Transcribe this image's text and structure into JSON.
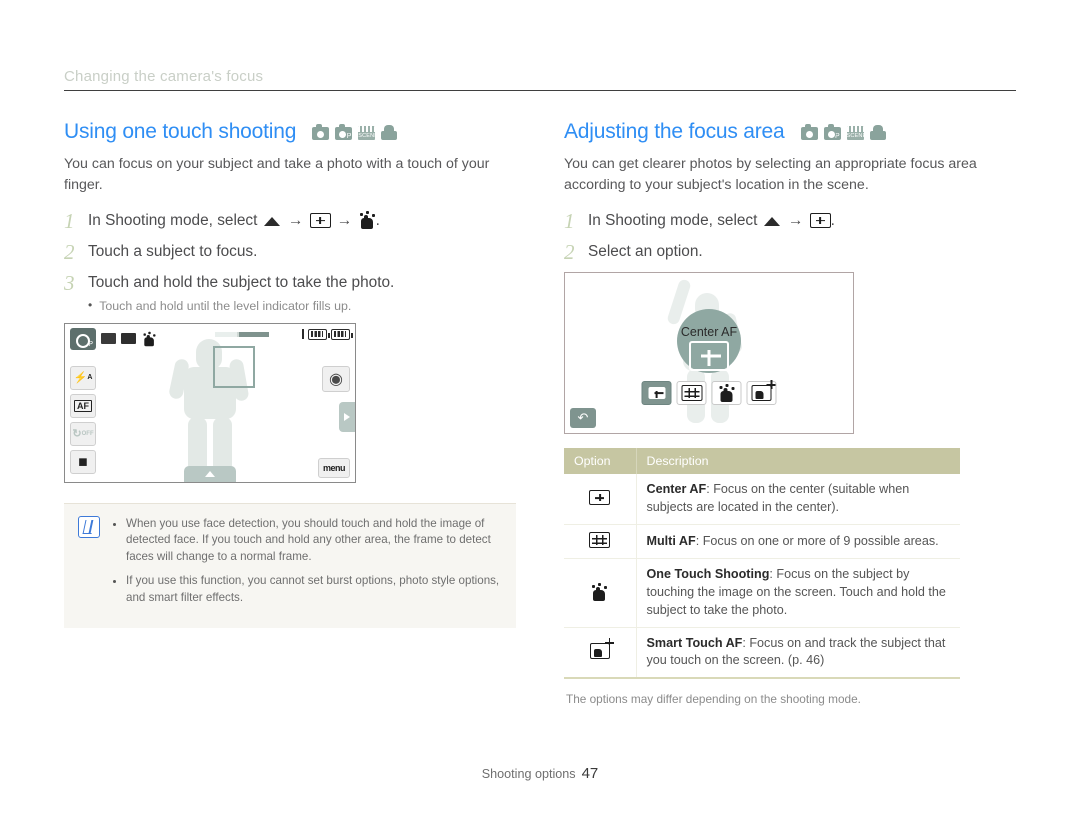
{
  "running_head": "Changing the camera's focus",
  "left_column": {
    "heading": "Using one touch shooting",
    "mode_icons": [
      "camera-icon",
      "camera-program-icon",
      "scene-icon",
      "movie-icon"
    ],
    "intro": "You can focus on your subject and take a photo with a touch of your finger.",
    "steps": [
      {
        "num": "1",
        "text_before": "In Shooting mode, select",
        "icons": [
          "triangle-up-icon",
          "boxed-plus-icon",
          "one-touch-hand-icon"
        ],
        "text_after": "."
      },
      {
        "num": "2",
        "text_before": "Touch a subject to focus.",
        "icons": [],
        "text_after": ""
      },
      {
        "num": "3",
        "text_before": "Touch and hold the subject to take the photo.",
        "icons": [],
        "text_after": "",
        "sub": "Touch and hold until the level indicator fills up."
      }
    ],
    "lcd": {
      "mode_badge": "P",
      "flash_label": "A",
      "af_label": "AF",
      "timer_label": "OFF",
      "menu_label": "menu"
    },
    "note": {
      "icon": "note-pen-icon",
      "items": [
        "When you use face detection, you should touch and hold the image of detected face. If you touch and hold any other area, the frame to detect faces will change to a normal frame.",
        "If you use this function, you cannot set burst options, photo style options, and smart filter effects."
      ]
    }
  },
  "right_column": {
    "heading": "Adjusting the focus area",
    "mode_icons": [
      "camera-icon",
      "camera-program-icon",
      "scene-icon",
      "movie-icon"
    ],
    "intro": "You can get clearer photos by selecting an appropriate focus area according to your subject's location in the scene.",
    "steps": [
      {
        "num": "1",
        "text_before": "In Shooting mode, select",
        "icons": [
          "triangle-up-icon",
          "boxed-plus-icon"
        ],
        "text_after": "."
      },
      {
        "num": "2",
        "text_before": "Select an option.",
        "icons": [],
        "text_after": ""
      }
    ],
    "lcd": {
      "center_label": "Center AF",
      "options": [
        "boxed-plus-icon",
        "multi-af-grid-icon",
        "one-touch-hand-icon",
        "smart-touch-af-icon"
      ],
      "back_label": "↶"
    },
    "table": {
      "headers": [
        "Option",
        "Description"
      ],
      "rows": [
        {
          "icon": "boxed-plus-icon",
          "term": "Center AF",
          "desc": ": Focus on the center (suitable when subjects are located in the center)."
        },
        {
          "icon": "multi-af-grid-icon",
          "term": "Multi AF",
          "desc": ": Focus on one or more of 9 possible areas."
        },
        {
          "icon": "one-touch-hand-icon",
          "term": "One Touch Shooting",
          "desc": ": Focus on the subject by touching the image on the screen. Touch and hold the subject to take the photo."
        },
        {
          "icon": "smart-touch-af-icon",
          "term": "Smart Touch AF",
          "desc": ": Focus on and track the subject that you touch on the screen. (p. 46)"
        }
      ]
    },
    "table_note": "The options may differ depending on the shooting mode."
  },
  "footer": {
    "section": "Shooting options",
    "page": "47"
  },
  "colors": {
    "heading_blue": "#2f8ef4",
    "step_number_green": "#c6d3b4",
    "table_header_khaki": "#c6c6a2",
    "body_text": "#58585a",
    "note_bg": "#f7f6f2"
  }
}
